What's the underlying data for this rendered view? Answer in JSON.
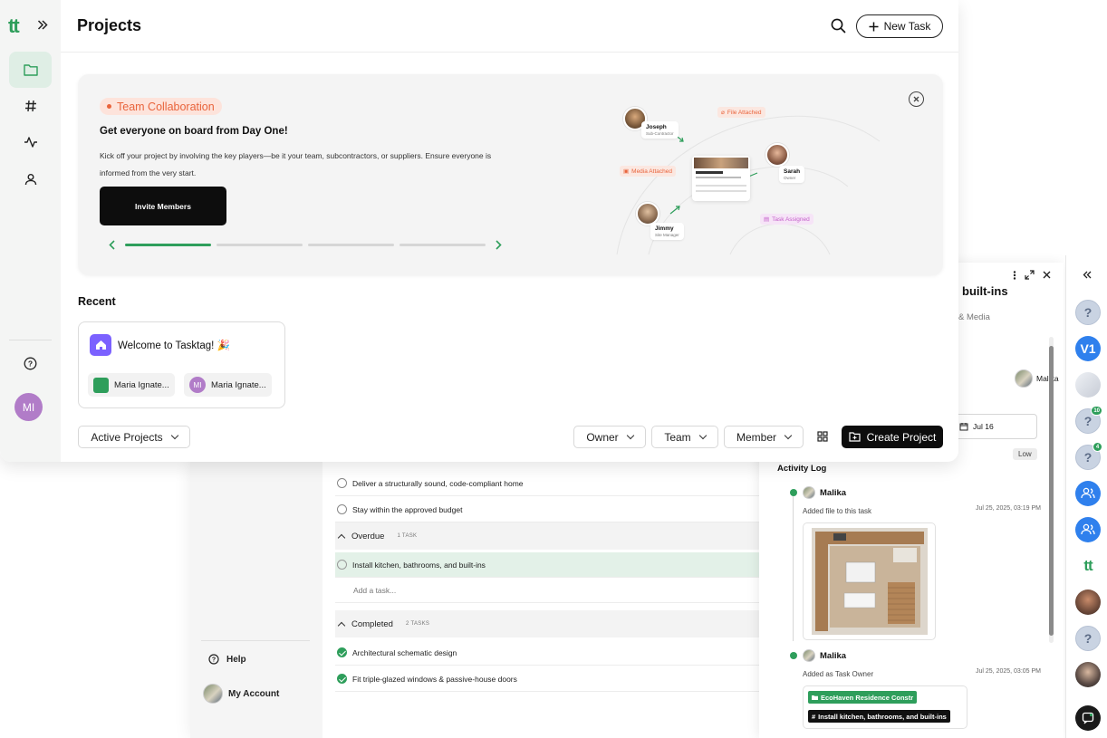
{
  "app": {
    "logo_text": "tt",
    "page_title": "Projects",
    "new_task_label": "New Task"
  },
  "onboarding": {
    "tag": "Team Collaboration",
    "heading": "Get everyone on board from Day One!",
    "body": "Kick off your project by involving the key players—be it your team, subcontractors, or suppliers. Ensure everyone is informed from the very start.",
    "cta": "Invite Members",
    "progress_step": 1,
    "progress_total": 4,
    "illustration": {
      "file_tag": "File Attached",
      "media_tag": "Media Attached",
      "task_tag": "Task Assigned",
      "people": [
        {
          "name": "Joseph",
          "role": "Sub-Contractor"
        },
        {
          "name": "Sarah",
          "role": "Owner"
        },
        {
          "name": "Jimmy",
          "role": "Site Manager"
        }
      ]
    }
  },
  "recent": {
    "title": "Recent",
    "card_title": "Welcome to Tasktag! 🎉",
    "chips": [
      "Maria Ignate...",
      "Maria Ignate..."
    ],
    "chip_initials": "MI"
  },
  "filters": {
    "active": "Active Projects",
    "owner": "Owner",
    "team": "Team",
    "member": "Member",
    "create": "Create Project"
  },
  "user": {
    "initials": "MI"
  },
  "task_list": {
    "rows_top": [
      "Deliver a structurally sound, code-compliant home",
      "Stay within the approved budget"
    ],
    "overdue": {
      "label": "Overdue",
      "count": "1 TASK"
    },
    "overdue_task": "Install kitchen, bathrooms, and built-ins",
    "add_task": "Add a task...",
    "completed": {
      "label": "Completed",
      "count": "2 TASKS"
    },
    "completed_tasks": [
      "Architectural schematic design",
      "Fit triple-glazed windows & passive-house doors"
    ],
    "help": "Help",
    "account": "My Account"
  },
  "detail": {
    "title_fragment": "built-ins",
    "tab_fragment": "& Media",
    "owner_name": "Malika",
    "date": "Jul 16",
    "priority": "Low",
    "activity_title": "Activity Log",
    "activities": [
      {
        "user": "Malika",
        "action": "Added file to this task",
        "time": "Jul 25, 2025, 03:19 PM"
      },
      {
        "user": "Malika",
        "action": "Added as Task Owner",
        "time": "Jul 25, 2025, 03:05 PM"
      }
    ],
    "project_tag": "EcoHaven Residence Constr",
    "task_tag": "Install kitchen, bathrooms, and built-ins"
  },
  "rail": {
    "v1_label": "V1",
    "badge_a": "10",
    "badge_b": "4",
    "logo": "tt"
  },
  "colors": {
    "brand_green": "#2e9e5b",
    "accent_orange": "#e9643c",
    "rail_blue": "#2f80ed",
    "avatar_purple": "#b17cc8"
  }
}
